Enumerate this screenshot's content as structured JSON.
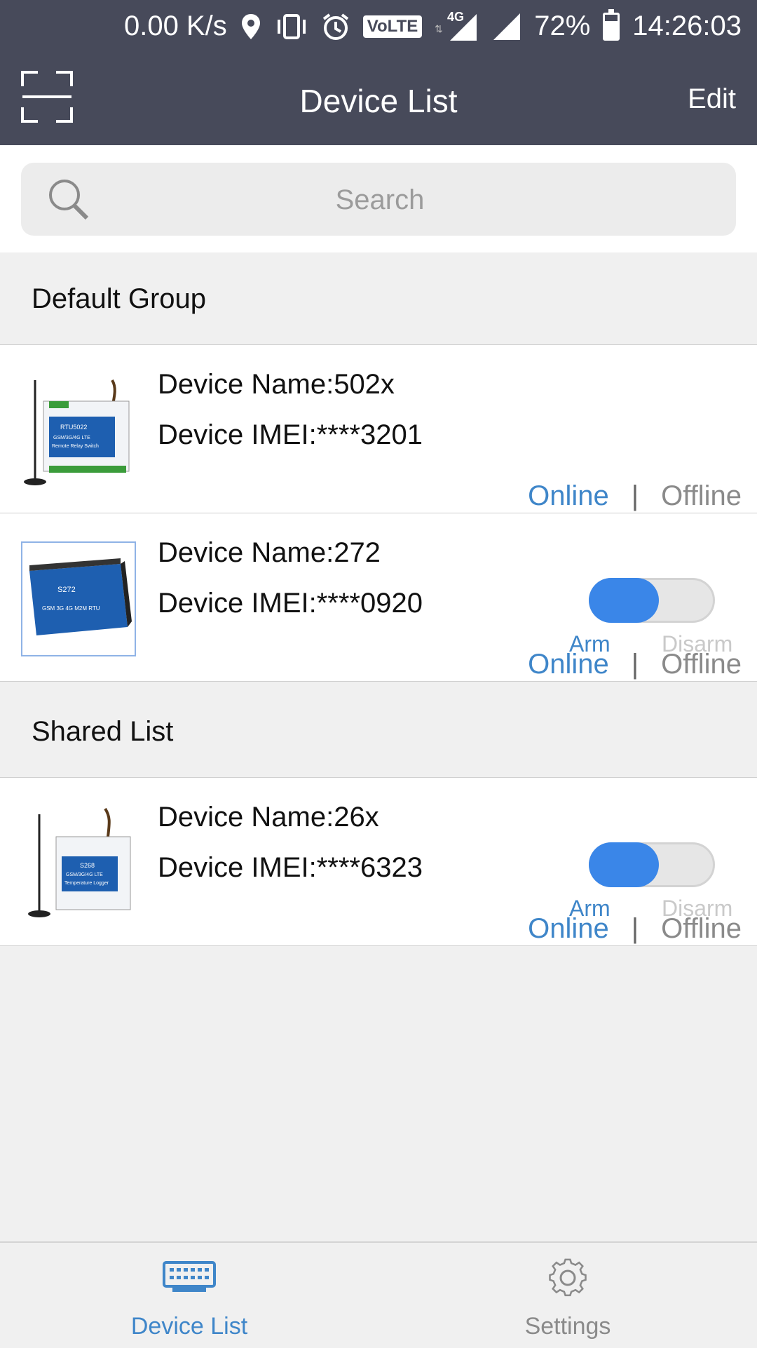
{
  "status_bar": {
    "speed": "0.00 K/s",
    "volte": "VoLTE",
    "network": "4G",
    "battery": "72%",
    "battery_level": 0.72,
    "time": "14:26:03"
  },
  "header": {
    "title": "Device List",
    "edit_label": "Edit"
  },
  "search": {
    "placeholder": "Search"
  },
  "groups": [
    {
      "title": "Default Group",
      "devices": [
        {
          "name": "Device Name:502x",
          "imei": "Device IMEI:****3201",
          "online_label": "Online",
          "separator": "|",
          "offline_label": "Offline",
          "has_arm_toggle": false
        },
        {
          "name": "Device Name:272",
          "imei": "Device IMEI:****0920",
          "online_label": "Online",
          "separator": "|",
          "offline_label": "Offline",
          "has_arm_toggle": true,
          "arm_label": "Arm",
          "disarm_label": "Disarm",
          "armed": true
        }
      ]
    },
    {
      "title": "Shared List",
      "devices": [
        {
          "name": "Device Name:26x",
          "imei": "Device IMEI:****6323",
          "online_label": "Online",
          "separator": "|",
          "offline_label": "Offline",
          "has_arm_toggle": true,
          "arm_label": "Arm",
          "disarm_label": "Disarm",
          "armed": true
        }
      ]
    }
  ],
  "bottom_nav": {
    "tabs": [
      {
        "label": "Device List",
        "icon": "device-list-icon",
        "active": true
      },
      {
        "label": "Settings",
        "icon": "gear-icon",
        "active": false
      }
    ]
  },
  "colors": {
    "header_bg": "#474a5a",
    "accent": "#3f86c9",
    "toggle_on": "#3a86e8"
  }
}
